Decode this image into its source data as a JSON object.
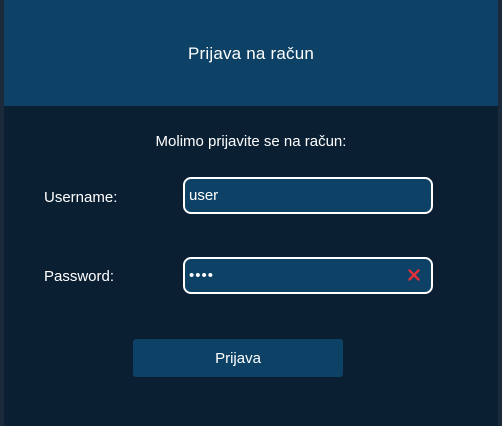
{
  "dialog": {
    "title": "Prijava na račun",
    "prompt": "Molimo prijavite se na račun:"
  },
  "form": {
    "username": {
      "label": "Username:",
      "value": "user"
    },
    "password": {
      "label": "Password:",
      "value": "abcd",
      "clear_icon": "close-x-icon",
      "clear_color": "#e0323c"
    },
    "submit_label": "Prijava"
  },
  "colors": {
    "header_bg": "#0d4166",
    "body_bg": "#0b1f33",
    "field_bg": "#0d4166",
    "button_bg": "#0d4166",
    "text": "#ffffff"
  }
}
